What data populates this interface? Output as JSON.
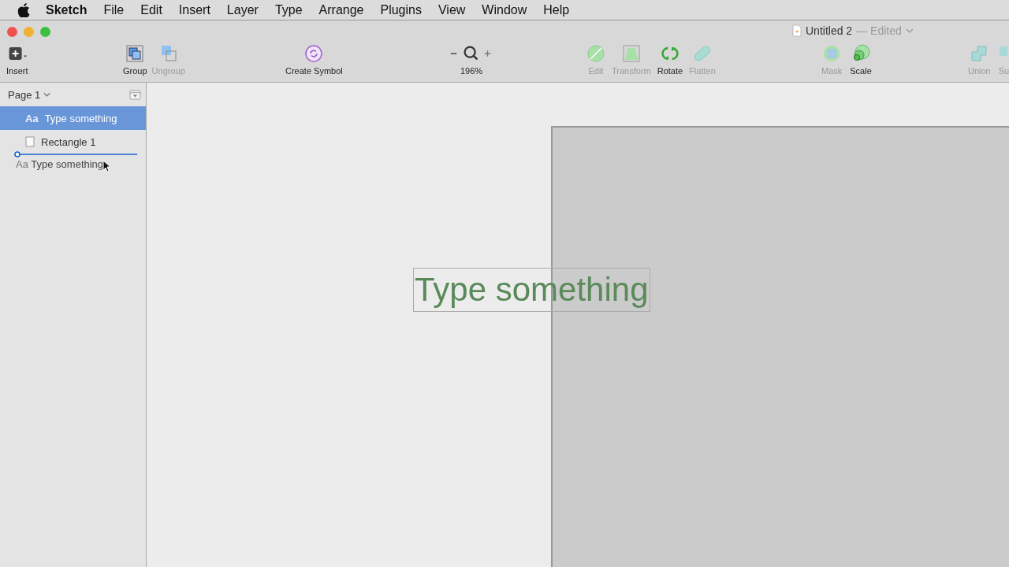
{
  "menu_bar": {
    "app_name": "Sketch",
    "items": [
      "File",
      "Edit",
      "Insert",
      "Layer",
      "Type",
      "Arrange",
      "Plugins",
      "View",
      "Window",
      "Help"
    ]
  },
  "window": {
    "title": "Untitled 2",
    "status": "— Edited"
  },
  "toolbar": [
    {
      "kind": "insert",
      "label": "Insert",
      "disabled": false
    },
    {
      "kind": "group",
      "label": "Group",
      "disabled": false
    },
    {
      "kind": "ungroup",
      "label": "Ungroup",
      "disabled": true
    },
    {
      "kind": "symbol",
      "label": "Create Symbol",
      "disabled": false
    },
    {
      "kind": "zoom",
      "label": "196%",
      "disabled": false
    },
    {
      "kind": "edit",
      "label": "Edit",
      "disabled": true
    },
    {
      "kind": "transform",
      "label": "Transform",
      "disabled": true
    },
    {
      "kind": "rotate",
      "label": "Rotate",
      "disabled": false
    },
    {
      "kind": "flatten",
      "label": "Flatten",
      "disabled": true
    },
    {
      "kind": "mask",
      "label": "Mask",
      "disabled": true
    },
    {
      "kind": "scale",
      "label": "Scale",
      "disabled": false
    },
    {
      "kind": "union",
      "label": "Union",
      "disabled": true
    },
    {
      "kind": "subtract",
      "label": "Su",
      "disabled": true
    }
  ],
  "sidebar": {
    "page": "Page 1",
    "layers": [
      {
        "kind": "text",
        "icon_text": "Aa",
        "name": "Type something",
        "selected": true
      },
      {
        "kind": "rectangle",
        "name": "Rectangle 1",
        "selected": false
      }
    ],
    "drag_ghost": {
      "icon_text": "Aa",
      "name": "Type something"
    }
  },
  "canvas": {
    "text_layer": "Type something"
  }
}
